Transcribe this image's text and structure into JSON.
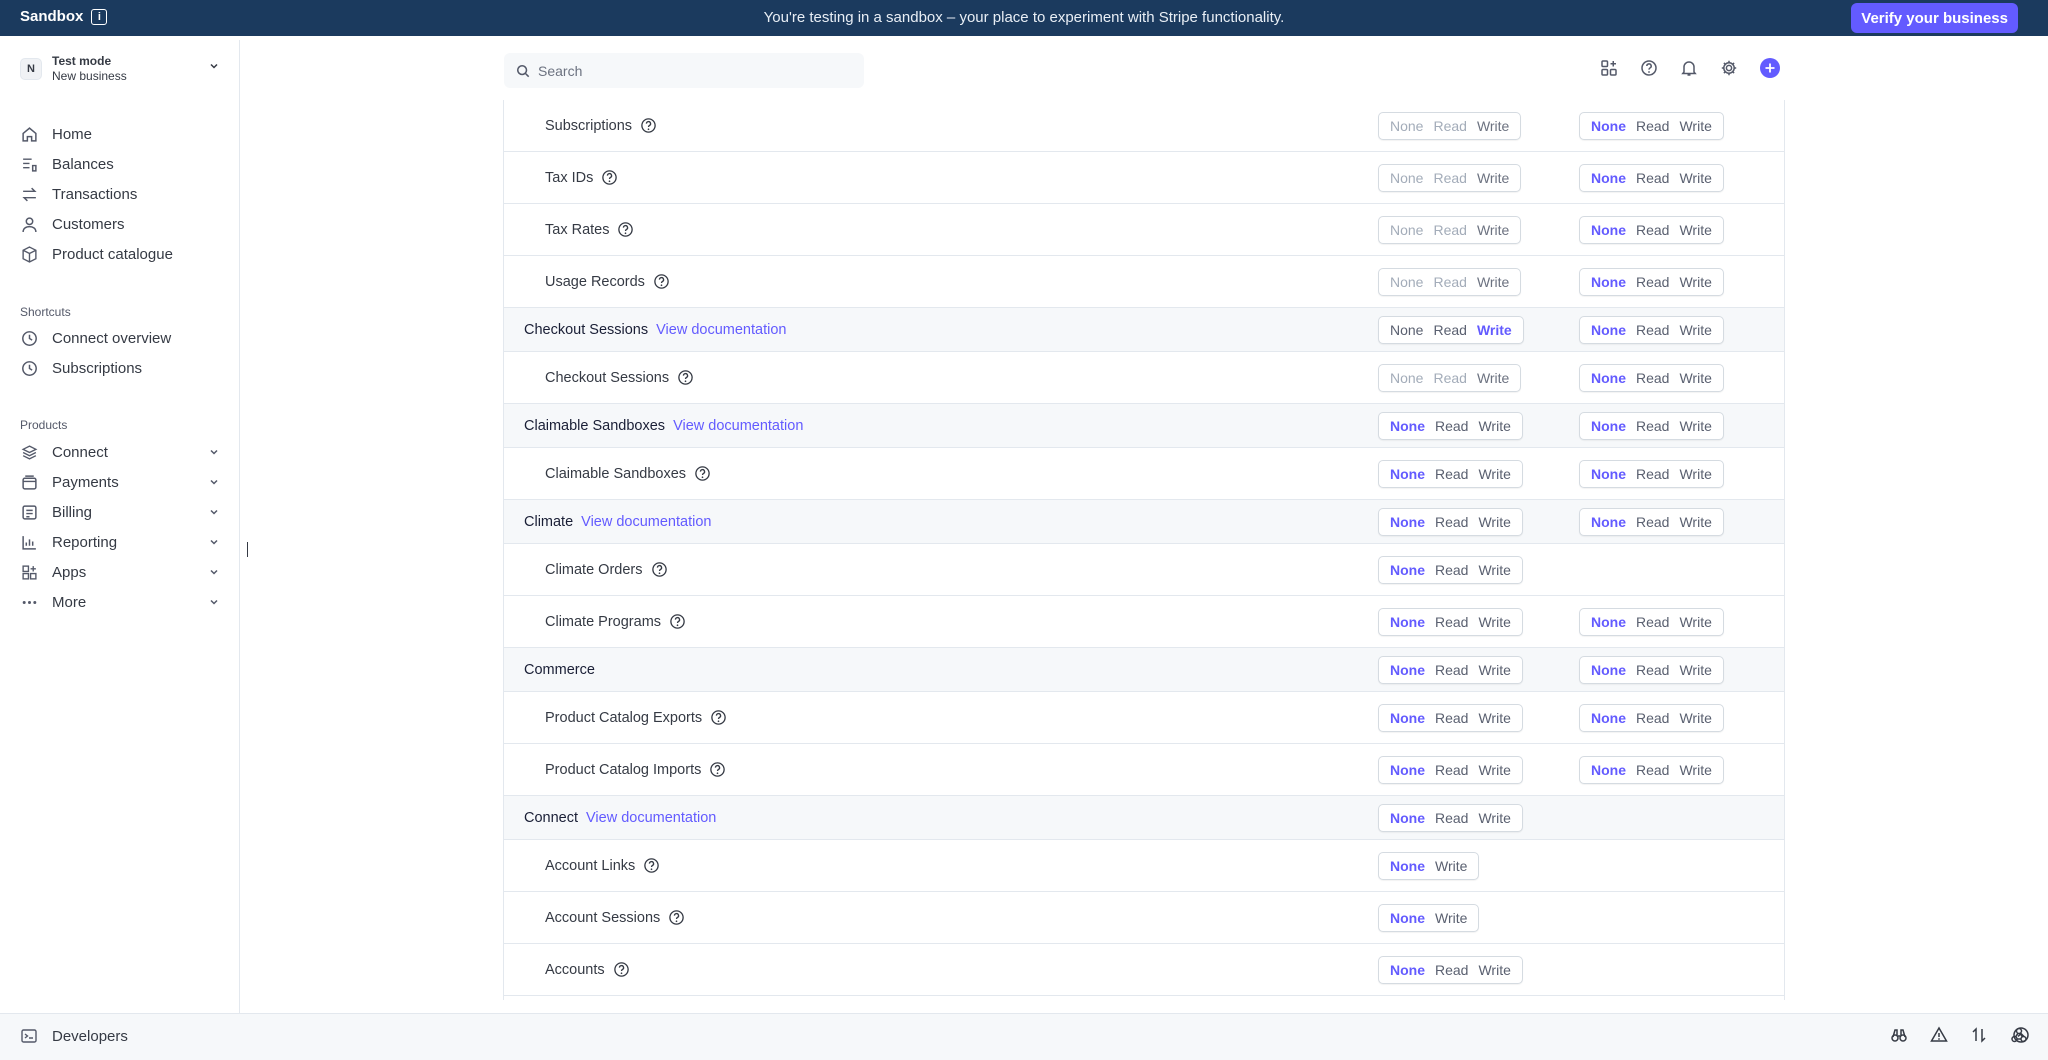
{
  "banner": {
    "brand": "Sandbox",
    "message": "You're testing in a sandbox – your place to experiment with Stripe functionality.",
    "verify_label": "Verify your business"
  },
  "account": {
    "avatar_initial": "N",
    "mode": "Test mode",
    "business": "New business"
  },
  "nav": {
    "main": [
      {
        "label": "Home",
        "icon": "home-icon"
      },
      {
        "label": "Balances",
        "icon": "balances-icon"
      },
      {
        "label": "Transactions",
        "icon": "transactions-icon"
      },
      {
        "label": "Customers",
        "icon": "customers-icon"
      },
      {
        "label": "Product catalogue",
        "icon": "product-catalogue-icon"
      }
    ],
    "shortcuts_label": "Shortcuts",
    "shortcuts": [
      {
        "label": "Connect overview",
        "icon": "clock-icon"
      },
      {
        "label": "Subscriptions",
        "icon": "clock-icon"
      }
    ],
    "products_label": "Products",
    "products": [
      {
        "label": "Connect",
        "icon": "connect-icon"
      },
      {
        "label": "Payments",
        "icon": "payments-icon"
      },
      {
        "label": "Billing",
        "icon": "billing-icon"
      },
      {
        "label": "Reporting",
        "icon": "reporting-icon"
      },
      {
        "label": "Apps",
        "icon": "apps-icon"
      },
      {
        "label": "More",
        "icon": "more-icon"
      }
    ]
  },
  "search": {
    "placeholder": "Search"
  },
  "bottom": {
    "developers_label": "Developers"
  },
  "permission_rows": [
    {
      "type": "sub",
      "name": "Subscriptions",
      "c1": {
        "opts": [
          "None",
          "Read",
          "Write"
        ],
        "selected": "Write",
        "dim": true
      },
      "c2": {
        "opts": [
          "None",
          "Read",
          "Write"
        ],
        "selected": "None"
      }
    },
    {
      "type": "sub",
      "name": "Tax IDs",
      "c1": {
        "opts": [
          "None",
          "Read",
          "Write"
        ],
        "selected": "Write",
        "dim": true
      },
      "c2": {
        "opts": [
          "None",
          "Read",
          "Write"
        ],
        "selected": "None"
      }
    },
    {
      "type": "sub",
      "name": "Tax Rates",
      "c1": {
        "opts": [
          "None",
          "Read",
          "Write"
        ],
        "selected": "Write",
        "dim": true
      },
      "c2": {
        "opts": [
          "None",
          "Read",
          "Write"
        ],
        "selected": "None"
      }
    },
    {
      "type": "sub",
      "name": "Usage Records",
      "c1": {
        "opts": [
          "None",
          "Read",
          "Write"
        ],
        "selected": "Write",
        "dim": true
      },
      "c2": {
        "opts": [
          "None",
          "Read",
          "Write"
        ],
        "selected": "None"
      }
    },
    {
      "type": "group",
      "name": "Checkout Sessions",
      "doc": "View documentation",
      "c1": {
        "opts": [
          "None",
          "Read",
          "Write"
        ],
        "selected": "Write"
      },
      "c2": {
        "opts": [
          "None",
          "Read",
          "Write"
        ],
        "selected": "None"
      }
    },
    {
      "type": "sub",
      "name": "Checkout Sessions",
      "c1": {
        "opts": [
          "None",
          "Read",
          "Write"
        ],
        "selected": "Write",
        "dim": true
      },
      "c2": {
        "opts": [
          "None",
          "Read",
          "Write"
        ],
        "selected": "None"
      }
    },
    {
      "type": "group",
      "name": "Claimable Sandboxes",
      "doc": "View documentation",
      "c1": {
        "opts": [
          "None",
          "Read",
          "Write"
        ],
        "selected": "None"
      },
      "c2": {
        "opts": [
          "None",
          "Read",
          "Write"
        ],
        "selected": "None"
      }
    },
    {
      "type": "sub",
      "name": "Claimable Sandboxes",
      "c1": {
        "opts": [
          "None",
          "Read",
          "Write"
        ],
        "selected": "None"
      },
      "c2": {
        "opts": [
          "None",
          "Read",
          "Write"
        ],
        "selected": "None"
      }
    },
    {
      "type": "group",
      "name": "Climate",
      "doc": "View documentation",
      "c1": {
        "opts": [
          "None",
          "Read",
          "Write"
        ],
        "selected": "None"
      },
      "c2": {
        "opts": [
          "None",
          "Read",
          "Write"
        ],
        "selected": "None"
      }
    },
    {
      "type": "sub",
      "name": "Climate Orders",
      "c1": {
        "opts": [
          "None",
          "Read",
          "Write"
        ],
        "selected": "None"
      },
      "c2": null
    },
    {
      "type": "sub",
      "name": "Climate Programs",
      "c1": {
        "opts": [
          "None",
          "Read",
          "Write"
        ],
        "selected": "None"
      },
      "c2": {
        "opts": [
          "None",
          "Read",
          "Write"
        ],
        "selected": "None"
      }
    },
    {
      "type": "group",
      "name": "Commerce",
      "doc": "",
      "c1": {
        "opts": [
          "None",
          "Read",
          "Write"
        ],
        "selected": "None"
      },
      "c2": {
        "opts": [
          "None",
          "Read",
          "Write"
        ],
        "selected": "None"
      }
    },
    {
      "type": "sub",
      "name": "Product Catalog Exports",
      "c1": {
        "opts": [
          "None",
          "Read",
          "Write"
        ],
        "selected": "None"
      },
      "c2": {
        "opts": [
          "None",
          "Read",
          "Write"
        ],
        "selected": "None"
      }
    },
    {
      "type": "sub",
      "name": "Product Catalog Imports",
      "c1": {
        "opts": [
          "None",
          "Read",
          "Write"
        ],
        "selected": "None"
      },
      "c2": {
        "opts": [
          "None",
          "Read",
          "Write"
        ],
        "selected": "None"
      }
    },
    {
      "type": "group",
      "name": "Connect",
      "doc": "View documentation",
      "c1": {
        "opts": [
          "None",
          "Read",
          "Write"
        ],
        "selected": "None"
      },
      "c2": null
    },
    {
      "type": "sub",
      "name": "Account Links",
      "c1": {
        "opts": [
          "None",
          "Write"
        ],
        "selected": "None"
      },
      "c2": null
    },
    {
      "type": "sub",
      "name": "Account Sessions",
      "c1": {
        "opts": [
          "None",
          "Write"
        ],
        "selected": "None"
      },
      "c2": null
    },
    {
      "type": "sub",
      "name": "Accounts",
      "c1": {
        "opts": [
          "None",
          "Read",
          "Write"
        ],
        "selected": "None"
      },
      "c2": null
    }
  ]
}
